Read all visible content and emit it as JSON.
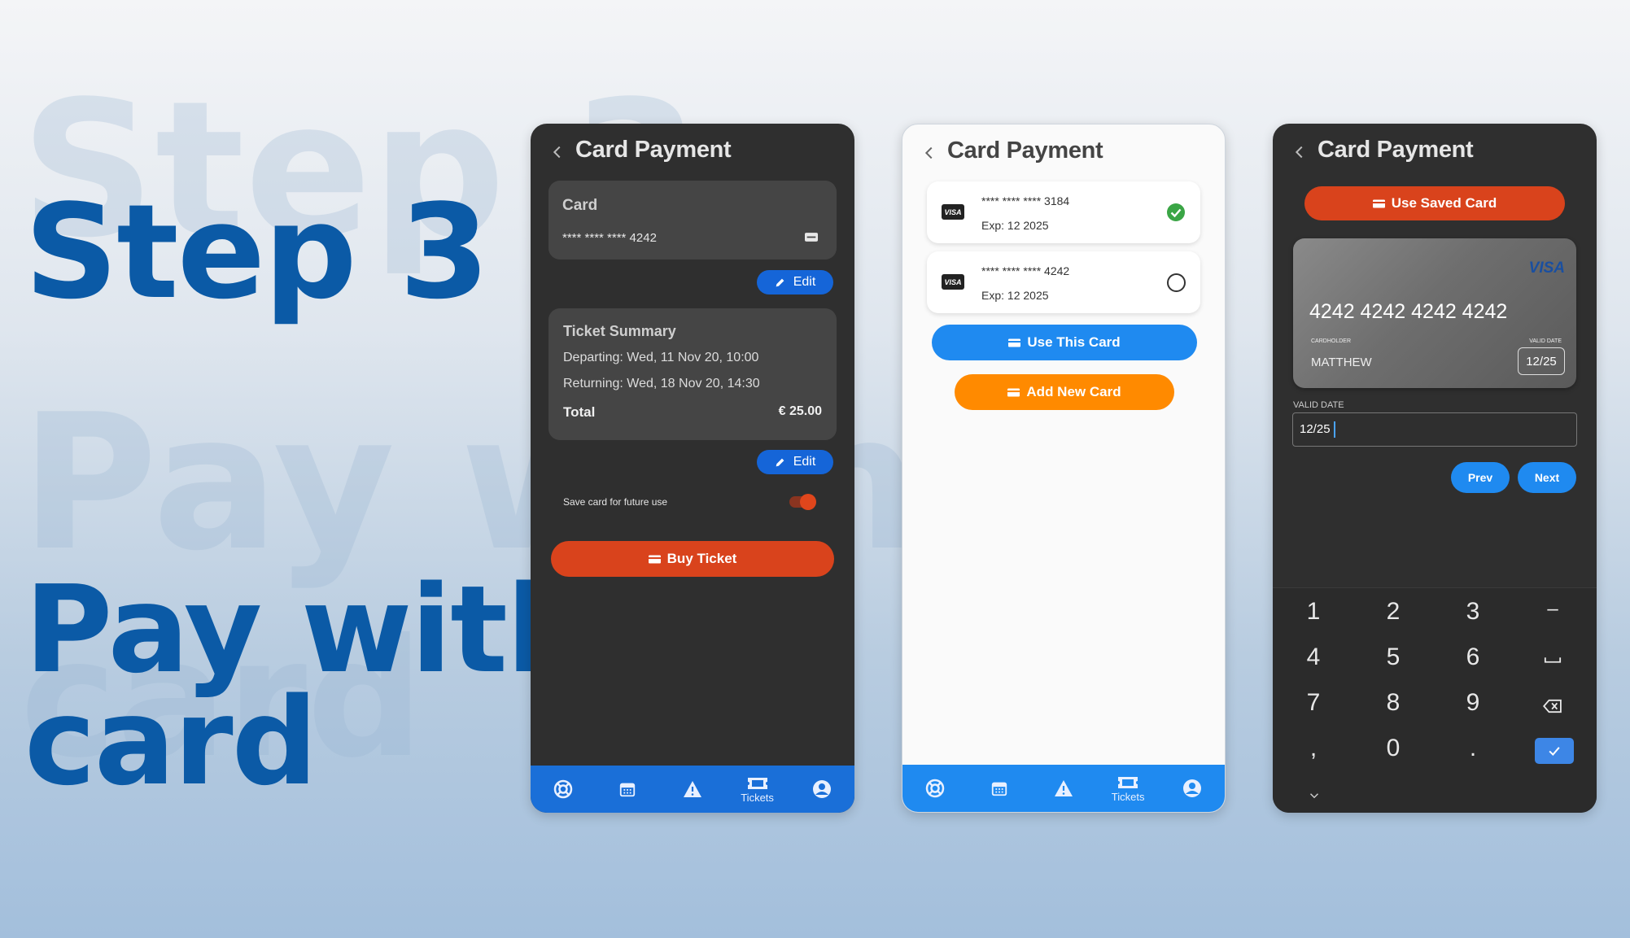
{
  "background": {
    "ghost_1": "Step 3",
    "ghost_2": "Pay with",
    "ghost_3": "card"
  },
  "hero": {
    "line1": "Step 3",
    "line2": "Pay with",
    "line3": "card"
  },
  "colors": {
    "hero_blue": "#0b5aa6",
    "primary_blue": "#1f8af0",
    "accent_red": "#d9431c",
    "accent_orange": "#ff8a00",
    "success_green": "#3aa545"
  },
  "screen1": {
    "title": "Card Payment",
    "card": {
      "label": "Card",
      "number": "**** **** **** 4242",
      "brand_icon": "visa-icon"
    },
    "edit_label": "Edit",
    "summary": {
      "title": "Ticket Summary",
      "departing": "Departing: Wed, 11 Nov 20, 10:00",
      "returning": "Returning: Wed, 18 Nov 20, 14:30",
      "total_label": "Total",
      "total_value": "€ 25.00"
    },
    "edit2_label": "Edit",
    "save_card_label": "Save card for future use",
    "save_card_on": true,
    "buy_label": "Buy Ticket",
    "nav": {
      "active": "Tickets",
      "tickets_label": "Tickets"
    }
  },
  "screen2": {
    "title": "Card Payment",
    "cards": [
      {
        "brand": "VISA",
        "number": "**** **** **** 3184",
        "exp": "Exp: 12 2025",
        "selected": true
      },
      {
        "brand": "VISA",
        "number": "**** **** **** 4242",
        "exp": "Exp: 12 2025",
        "selected": false
      }
    ],
    "use_label": "Use This Card",
    "add_label": "Add New Card",
    "nav": {
      "tickets_label": "Tickets"
    }
  },
  "screen3": {
    "title": "Card Payment",
    "use_saved_label": "Use Saved Card",
    "card_brand": "VISA",
    "card_number": "4242 4242 4242 4242",
    "cardholder_caption": "CARDHOLDER",
    "cardholder": "MATTHEW",
    "valid_caption": "VALID DATE",
    "valid_value": "12/25",
    "field_label": "VALID DATE",
    "field_value": "12/25",
    "prev_label": "Prev",
    "next_label": "Next",
    "keys": [
      "1",
      "2",
      "3",
      "–",
      "4",
      "5",
      "6",
      "␣",
      "7",
      "8",
      "9",
      "⌫",
      ",",
      "0",
      "."
    ]
  }
}
